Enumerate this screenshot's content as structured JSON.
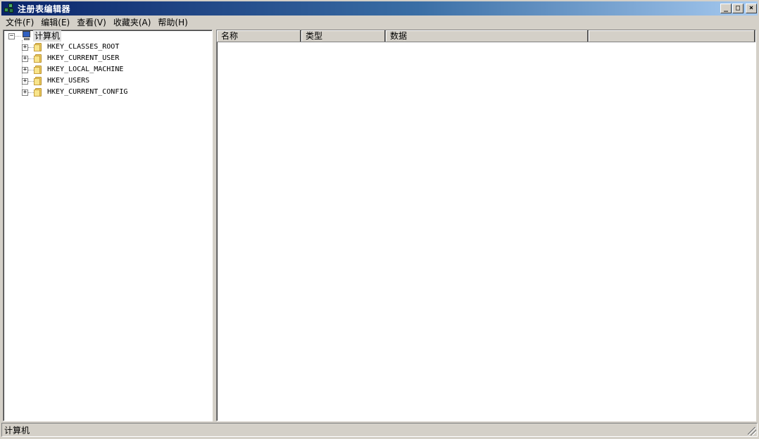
{
  "window": {
    "title": "注册表编辑器",
    "controls": {
      "minimize": "_",
      "maximize": "□",
      "close": "×"
    }
  },
  "menu": {
    "items": [
      {
        "label": "文件(F)"
      },
      {
        "label": "编辑(E)"
      },
      {
        "label": "查看(V)"
      },
      {
        "label": "收藏夹(A)"
      },
      {
        "label": "帮助(H)"
      }
    ]
  },
  "tree": {
    "root": {
      "label": "计算机",
      "expander": "−"
    },
    "children": [
      {
        "label": "HKEY_CLASSES_ROOT",
        "expander": "+"
      },
      {
        "label": "HKEY_CURRENT_USER",
        "expander": "+"
      },
      {
        "label": "HKEY_LOCAL_MACHINE",
        "expander": "+"
      },
      {
        "label": "HKEY_USERS",
        "expander": "+"
      },
      {
        "label": "HKEY_CURRENT_CONFIG",
        "expander": "+"
      }
    ]
  },
  "list": {
    "columns": [
      {
        "label": "名称"
      },
      {
        "label": "类型"
      },
      {
        "label": "数据"
      },
      {
        "label": ""
      }
    ]
  },
  "status": {
    "text": "计算机"
  },
  "colors": {
    "title_start": "#0a246a",
    "title_end": "#a6caf0",
    "face": "#d4d0c8"
  }
}
